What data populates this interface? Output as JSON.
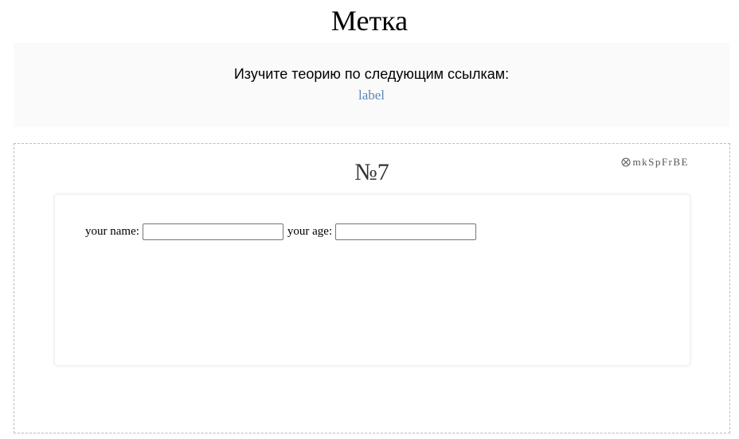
{
  "page": {
    "title": "Метка"
  },
  "theory": {
    "text": "Изучите теорию по следующим ссылкам:",
    "link_label": "label"
  },
  "task": {
    "number": "№7",
    "id": "mkSpFrBE",
    "id_icon": "circled-x-icon",
    "form": {
      "name_label": "your name:",
      "name_value": "",
      "age_label": "your age:",
      "age_value": ""
    }
  },
  "colors": {
    "link": "#5b87b8",
    "theory_bg": "#fafafa",
    "border": "#bdbdbd"
  }
}
